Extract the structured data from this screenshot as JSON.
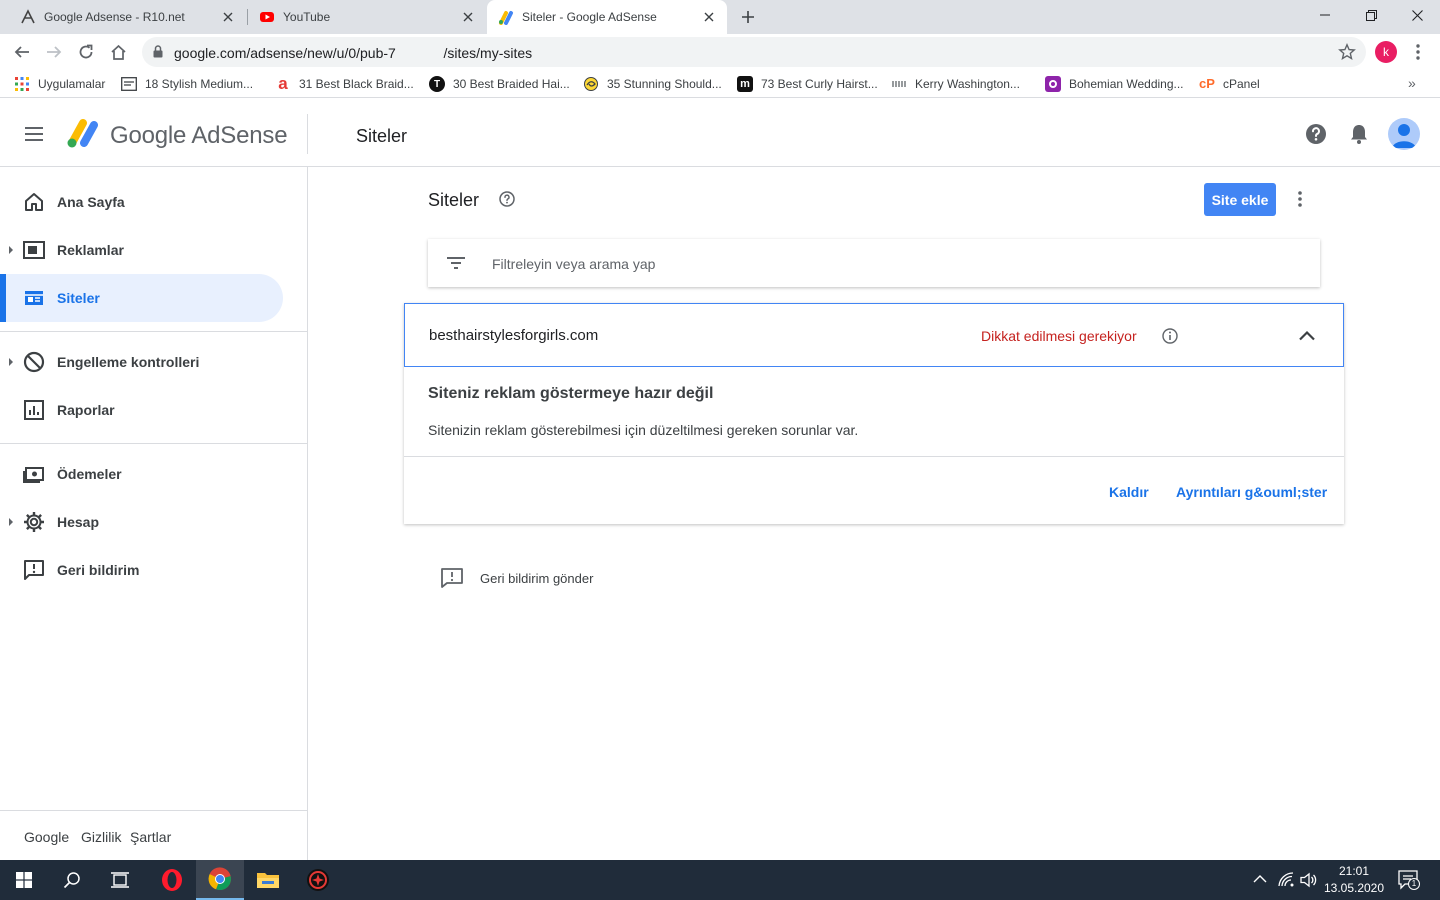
{
  "browser": {
    "tabs": [
      {
        "title": "Google Adsense - R10.net"
      },
      {
        "title": "YouTube"
      },
      {
        "title": "Siteler - Google AdSense"
      }
    ],
    "url": "google.com/adsense/new/u/0/pub-7                 /sites/my-sites",
    "profile_initial": "k",
    "bookmarks": [
      {
        "label": "Uygulamalar",
        "icon": "apps-grid-icon"
      },
      {
        "label": "18 Stylish Medium...",
        "icon": "page-icon"
      },
      {
        "label": "31 Best Black Braid...",
        "icon": "a-letter-icon"
      },
      {
        "label": "30 Best Braided Hai...",
        "icon": "t-circle-icon"
      },
      {
        "label": "35 Stunning Should...",
        "icon": "swirl-icon"
      },
      {
        "label": "73 Best Curly Hairst...",
        "icon": "m-square-icon"
      },
      {
        "label": "Kerry Washington...",
        "icon": "bars-icon"
      },
      {
        "label": "Bohemian Wedding...",
        "icon": "ring-icon"
      },
      {
        "label": "cPanel",
        "icon": "cpanel-icon"
      }
    ]
  },
  "app": {
    "brand": "Google AdSense",
    "header_title": "Siteler"
  },
  "sidebar": {
    "items": [
      {
        "label": "Ana Sayfa"
      },
      {
        "label": "Reklamlar"
      },
      {
        "label": "Siteler"
      },
      {
        "label": "Engelleme kontrolleri"
      },
      {
        "label": "Raporlar"
      },
      {
        "label": "Ödemeler"
      },
      {
        "label": "Hesap"
      },
      {
        "label": "Geri bildirim"
      }
    ],
    "footer": {
      "google": "Google",
      "privacy": "Gizlilik",
      "terms": "Şartlar"
    }
  },
  "main": {
    "page_title": "Siteler",
    "add_site_button": "Site ekle",
    "filter_placeholder": "Filtreleyin veya arama yap",
    "site": {
      "domain": "besthairstylesforgirls.com",
      "status": "Dikkat edilmesi gerekiyor",
      "message_title": "Siteniz reklam göstermeye hazır değil",
      "message_body": "Sitenizin reklam gösterebilmesi için düzeltilmesi gereken sorunlar var.",
      "remove_link": "Kaldır",
      "details_link": "Ayrıntıları g&ouml;ster"
    },
    "feedback_link": "Geri bildirim gönder"
  },
  "taskbar": {
    "time": "21:01",
    "date": "13.05.2020",
    "notification_count": "1"
  },
  "colors": {
    "accent": "#1a73e8",
    "warning": "#c5221f",
    "button": "#4285f4"
  }
}
